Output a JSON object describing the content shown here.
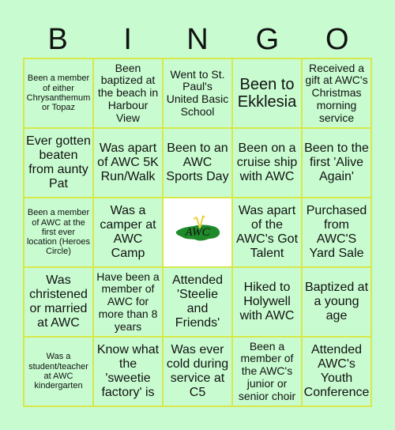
{
  "header": {
    "letters": [
      "B",
      "I",
      "N",
      "G",
      "O"
    ]
  },
  "colors": {
    "background": "#c8fcd0",
    "grid_line": "#d6e84a",
    "free_cell": "#ffffff",
    "logo_green": "#1f8a2a",
    "logo_yellow": "#e8d23a"
  },
  "cells": [
    "Been a member of either Chrysanthemum or Topaz",
    "Been baptized at the beach in Harbour View",
    "Went to St. Paul's United Basic School",
    "Been to Ekklesia",
    "Received a gift at AWC's Christmas morning service",
    "Ever gotten beaten from aunty Pat",
    "Was apart of AWC 5K Run/Walk",
    "Been to an AWC Sports Day",
    "Been on a cruise ship with AWC",
    "Been to the first 'Alive Again'",
    "Been a member of AWC at the first ever location (Heroes Circle)",
    "Was a camper at AWC Camp",
    "",
    "Was apart of the AWC's Got Talent",
    "Purchased from AWC'S Yard Sale",
    "Was christened or married at AWC",
    "Have been a member of AWC for more than 8 years",
    "Attended 'Steelie and Friends'",
    "Hiked to Holywell with AWC",
    "Baptized at a young age",
    "Was a student/teacher at AWC kindergarten",
    "Know what the 'sweetie factory' is",
    "Was ever cold during service at C5",
    "Been a member of the AWC's junior or senior choir",
    "Attended AWC's Youth Conference"
  ],
  "free_space": {
    "icon": "awc-logo-icon",
    "logo_text": "AWC"
  }
}
